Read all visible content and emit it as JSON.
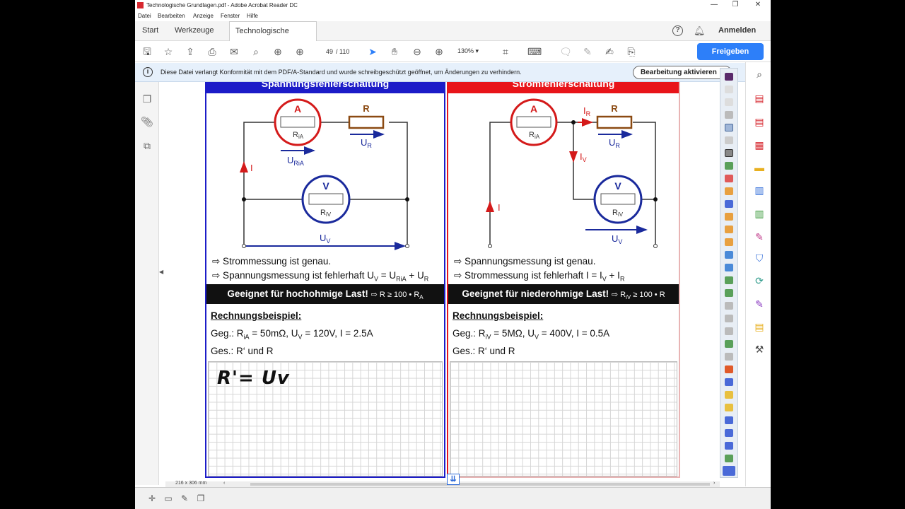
{
  "window": {
    "title": "Technologische Grundlagen.pdf - Adobe Acrobat Reader DC",
    "controls": {
      "minimize": "—",
      "restore": "❐",
      "close": "✕"
    }
  },
  "menu": [
    "Datei",
    "Bearbeiten",
    "Anzeige",
    "Fenster",
    "Hilfe"
  ],
  "tabs": {
    "start": "Start",
    "tools": "Werkzeuge",
    "document": "Technologische Gru...",
    "close": "×",
    "signin": "Anmelden",
    "help": "?"
  },
  "toolbar": {
    "page_current": "49",
    "page_total": "/ 110",
    "zoom": "130%",
    "share": "Freigeben"
  },
  "infobar": {
    "message": "Diese Datei verlangt Konformität mit dem PDF/A-Standard und wurde schreibgeschützt geöffnet, um Änderungen zu verhindern.",
    "button": "Bearbeitung aktivieren"
  },
  "status": {
    "page_size": "216 x 306 mm"
  },
  "doc": {
    "left": {
      "header": "Spannungsfehlerschaltung",
      "header_color": "#1c1cc8",
      "ammeter": "A",
      "ammeter_r": "R",
      "ammeter_r_sub": "iA",
      "resistor": "R",
      "ur": "U",
      "ur_sub": "R",
      "uria": "U",
      "uria_sub": "RiA",
      "current": "I",
      "voltmeter": "V",
      "voltmeter_r": "R",
      "voltmeter_r_sub": "iV",
      "uv": "U",
      "uv_sub": "V",
      "line1": "⇨ Strommessung ist genau.",
      "line2a": "⇨ Spannungsmessung ist fehlerhaft U",
      "line2b": "V",
      "line2c": " = U",
      "line2d": "RiA",
      "line2e": " + U",
      "line2f": "R",
      "bar": "Geeignet für hochohmige Last!",
      "bar_cond_a": "⇨ R ≥ 100 • R",
      "bar_cond_b": "A",
      "example_title": "Rechnungsbeispiel:",
      "given_a": "Geg.: R",
      "given_b": "iA",
      "given_c": " = 50mΩ, U",
      "given_d": "V",
      "given_e": " = 120V, I = 2.5A",
      "wanted": "Ges.: R‘ und R",
      "handwriting": "R'= Uv"
    },
    "right": {
      "header": "Stromfehlerschaltung",
      "header_color": "#e8141a",
      "ammeter": "A",
      "ammeter_r": "R",
      "ammeter_r_sub": "iA",
      "ir": "I",
      "ir_sub": "R",
      "resistor": "R",
      "ur": "U",
      "ur_sub": "R",
      "iv": "I",
      "iv_sub": "V",
      "current": "I",
      "voltmeter": "V",
      "voltmeter_r": "R",
      "voltmeter_r_sub": "iV",
      "uv": "U",
      "uv_sub": "V",
      "line1": "⇨ Spannungsmessung ist genau.",
      "line2a": "⇨ Strommessung ist fehlerhaft I = I",
      "line2b": "V",
      "line2c": " + I",
      "line2d": "R",
      "bar": "Geeignet für niederohmige Last!",
      "bar_cond_a": "⇨ R",
      "bar_cond_b": "iV",
      "bar_cond_c": " ≥ 100 • R",
      "example_title": "Rechnungsbeispiel:",
      "given_a": "Geg.: R",
      "given_b": "iV",
      "given_c": " = 5MΩ, U",
      "given_d": "V",
      "given_e": " = 400V, I = 0.5A",
      "wanted": "Ges.: R‘ und R"
    }
  },
  "colors": {
    "share": "#2d7ff9",
    "info_bg": "#e6f0fb",
    "circuit_red": "#d41a1a",
    "circuit_blue": "#1a2a9c",
    "resistor_brown": "#8b4a12"
  },
  "icons": [
    "save-icon",
    "star-icon",
    "upload-icon",
    "print-icon",
    "mail-icon",
    "search-icon",
    "page-up-icon",
    "page-down-icon",
    "select-icon",
    "hand-icon",
    "zoom-out-icon",
    "zoom-in-icon",
    "crop-icon",
    "keyboard-icon",
    "comment-icon",
    "pen-icon",
    "sign-icon",
    "stamp-icon"
  ]
}
